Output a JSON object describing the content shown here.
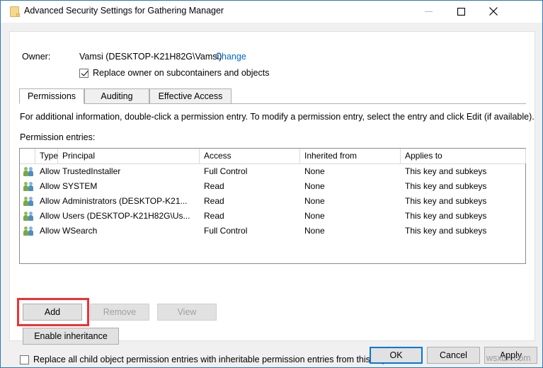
{
  "window": {
    "title": "Advanced Security Settings for Gathering Manager",
    "icon": "folder-key-icon",
    "controls": {
      "minimize": "minimize-icon",
      "maximize": "maximize-icon",
      "close": "close-icon"
    }
  },
  "owner": {
    "label": "Owner:",
    "value": "Vamsi (DESKTOP-K21H82G\\Vamsi)",
    "change_link": "Change",
    "replace_checkbox": {
      "label": "Replace owner on subcontainers and objects",
      "checked": true
    }
  },
  "tabs": [
    {
      "label": "Permissions",
      "active": true
    },
    {
      "label": "Auditing",
      "active": false
    },
    {
      "label": "Effective Access",
      "active": false
    }
  ],
  "info_text": "For additional information, double-click a permission entry. To modify a permission entry, select the entry and click Edit (if available).",
  "entries_label": "Permission entries:",
  "table": {
    "columns": [
      "",
      "Type",
      "Principal",
      "Access",
      "Inherited from",
      "Applies to"
    ],
    "rows": [
      {
        "icon": "users-group-icon",
        "type": "Allow",
        "principal": "TrustedInstaller",
        "access": "Full Control",
        "inherited_from": "None",
        "applies_to": "This key and subkeys"
      },
      {
        "icon": "users-group-icon",
        "type": "Allow",
        "principal": "SYSTEM",
        "access": "Read",
        "inherited_from": "None",
        "applies_to": "This key and subkeys"
      },
      {
        "icon": "users-group-icon",
        "type": "Allow",
        "principal": "Administrators (DESKTOP-K21...",
        "access": "Read",
        "inherited_from": "None",
        "applies_to": "This key and subkeys"
      },
      {
        "icon": "users-group-icon",
        "type": "Allow",
        "principal": "Users (DESKTOP-K21H82G\\Us...",
        "access": "Read",
        "inherited_from": "None",
        "applies_to": "This key and subkeys"
      },
      {
        "icon": "users-group-icon",
        "type": "Allow",
        "principal": "WSearch",
        "access": "Full Control",
        "inherited_from": "None",
        "applies_to": "This key and subkeys"
      }
    ]
  },
  "actions": {
    "add": "Add",
    "remove": "Remove",
    "view": "View",
    "enable_inheritance": "Enable inheritance",
    "remove_disabled": true,
    "view_disabled": true,
    "highlight_color": "#ed3237"
  },
  "replace_all_checkbox": {
    "label": "Replace all child object permission entries with inheritable permission entries from this object",
    "checked": false
  },
  "footer": {
    "ok": "OK",
    "cancel": "Cancel",
    "apply": "Apply"
  },
  "watermark": "wsxdn.com"
}
